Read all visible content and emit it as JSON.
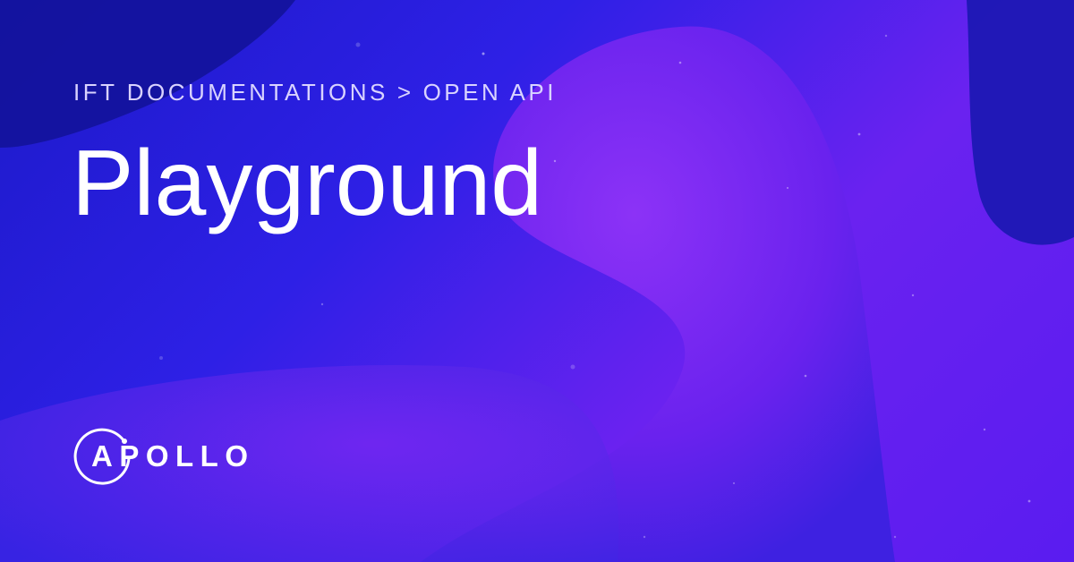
{
  "breadcrumb": {
    "root": "IFT DOCUMENTATIONS",
    "separator": ">",
    "current": "OPEN API"
  },
  "title": "Playground",
  "brand": {
    "name": "APOLLO"
  },
  "colors": {
    "background_blue": "#2a1fd8",
    "accent_purple": "#8a2cf5",
    "dark_navy": "#14129a",
    "breadcrumb_text": "#d9d3ff",
    "title_text": "#ffffff"
  }
}
